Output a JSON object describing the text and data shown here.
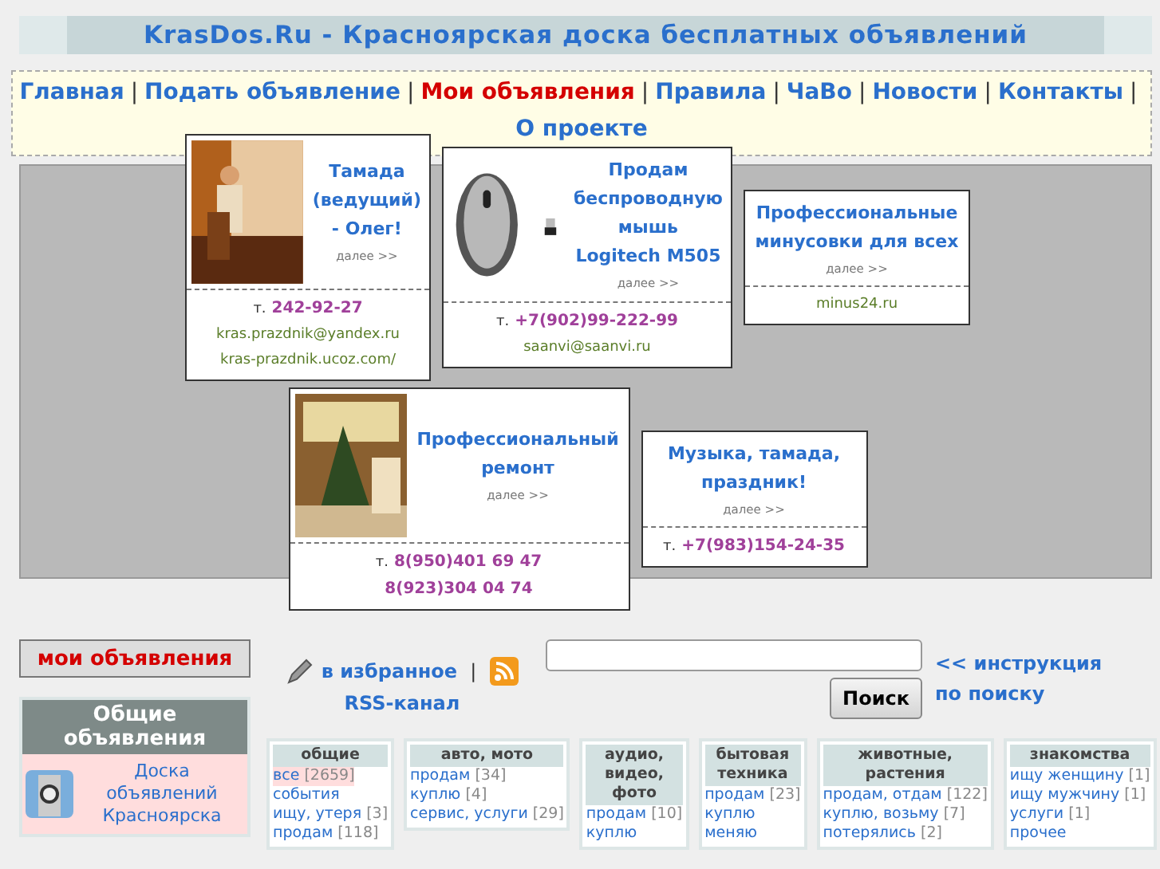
{
  "site_title": "KrasDos.Ru - Красноярская доска бесплатных объявлений",
  "nav": [
    {
      "label": "Главная",
      "selected": false
    },
    {
      "label": "Подать объявление",
      "selected": false
    },
    {
      "label": "Мои объявления",
      "selected": true
    },
    {
      "label": "Правила",
      "selected": false
    },
    {
      "label": "ЧаВо",
      "selected": false
    },
    {
      "label": "Новости",
      "selected": false
    },
    {
      "label": "Контакты",
      "selected": false
    },
    {
      "label": "О проекте",
      "selected": false
    }
  ],
  "ads": [
    {
      "kind": "picture",
      "title": "Тамада (ведущий) - Олег!",
      "more": "далее >>",
      "phone_prefix": "т.",
      "phones": [
        "242-92-27"
      ],
      "contacts": [
        "kras.prazdnik@yandex.ru",
        "kras-prazdnik.ucoz.com/"
      ]
    },
    {
      "kind": "picture",
      "title": "Продам беспроводную мышь Logitech M505",
      "more": "далее >>",
      "phone_prefix": "т.",
      "phones": [
        "+7(902)99-222-99"
      ],
      "contacts": [
        "saanvi@saanvi.ru"
      ]
    },
    {
      "title": "Профессиональные минусовки для всех",
      "more": "далее >>",
      "contacts": [
        "minus24.ru"
      ]
    },
    {
      "kind": "picture",
      "title": "Профессиональный ремонт",
      "more": "далее >>",
      "phone_prefix": "т.",
      "phones": [
        "8(950)401 69 47",
        "8(923)304 04 74"
      ]
    },
    {
      "title": "Музыка, тамада, праздник!",
      "more": "далее >>",
      "phone_prefix": "т.",
      "phones": [
        "+7(983)154-24-35"
      ]
    }
  ],
  "my_ads_button": "мои объявления",
  "sidebar": {
    "title": "Общие объявления",
    "items": [
      {
        "label": "Доска объявлений Красноярска",
        "selected": true
      }
    ]
  },
  "favorites_link": "в избранное",
  "separator": "|",
  "rss_link": "RSS-канал",
  "search": {
    "button": "Поиск",
    "help_link": "<< инструкция по поиску"
  },
  "categories": [
    {
      "title": "общие",
      "items": [
        {
          "label": "все",
          "count": "[2659]",
          "selected": true
        },
        {
          "label": "события",
          "selected": false
        },
        {
          "label": "ищу, утеря",
          "count": "[3]",
          "selected": false
        },
        {
          "label": "продам",
          "count": "[118]",
          "selected": false
        }
      ]
    },
    {
      "title": "авто, мото",
      "items": [
        {
          "label": "продам",
          "count": "[34]",
          "selected": false
        },
        {
          "label": "куплю",
          "count": "[4]",
          "selected": false
        },
        {
          "label": "сервис, услуги",
          "count": "[29]",
          "selected": false
        }
      ]
    },
    {
      "title": "аудио, видео, фото",
      "items": [
        {
          "label": "продам",
          "count": "[10]",
          "selected": false
        },
        {
          "label": "куплю",
          "selected": false
        }
      ]
    },
    {
      "title": "бытовая техника",
      "items": [
        {
          "label": "продам",
          "count": "[23]",
          "selected": false
        },
        {
          "label": "куплю",
          "selected": false
        },
        {
          "label": "меняю",
          "selected": false
        }
      ]
    },
    {
      "title": "животные, растения",
      "items": [
        {
          "label": "продам, отдам",
          "count": "[122]",
          "selected": false
        },
        {
          "label": "куплю, возьму",
          "count": "[7]",
          "selected": false
        },
        {
          "label": "потерялись",
          "count": "[2]",
          "selected": false
        }
      ]
    },
    {
      "title": "знакомства",
      "items": [
        {
          "label": "ищу женщину",
          "count": "[1]",
          "selected": false
        },
        {
          "label": "ищу мужчину",
          "count": "[1]",
          "selected": false
        },
        {
          "label": "услуги",
          "count": "[1]",
          "selected": false
        },
        {
          "label": "прочее",
          "selected": false
        }
      ]
    }
  ]
}
